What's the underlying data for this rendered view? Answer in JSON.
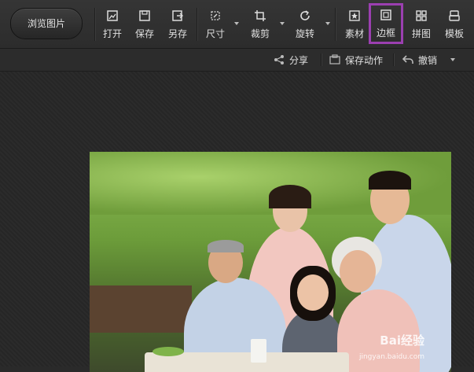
{
  "toolbar": {
    "browse_label": "浏览图片",
    "tools": {
      "open": "打开",
      "save": "保存",
      "save_as": "另存",
      "size": "尺寸",
      "crop": "裁剪",
      "rotate": "旋转",
      "material": "素材",
      "border": "边框",
      "collage": "拼图",
      "template": "模板"
    },
    "active_tool": "border",
    "accent": "#9b3fb0"
  },
  "subbar": {
    "share": "分享",
    "save_action": "保存动作",
    "undo": "撤销"
  },
  "watermark": {
    "text": "经验",
    "url": "jingyan.baidu.com"
  }
}
